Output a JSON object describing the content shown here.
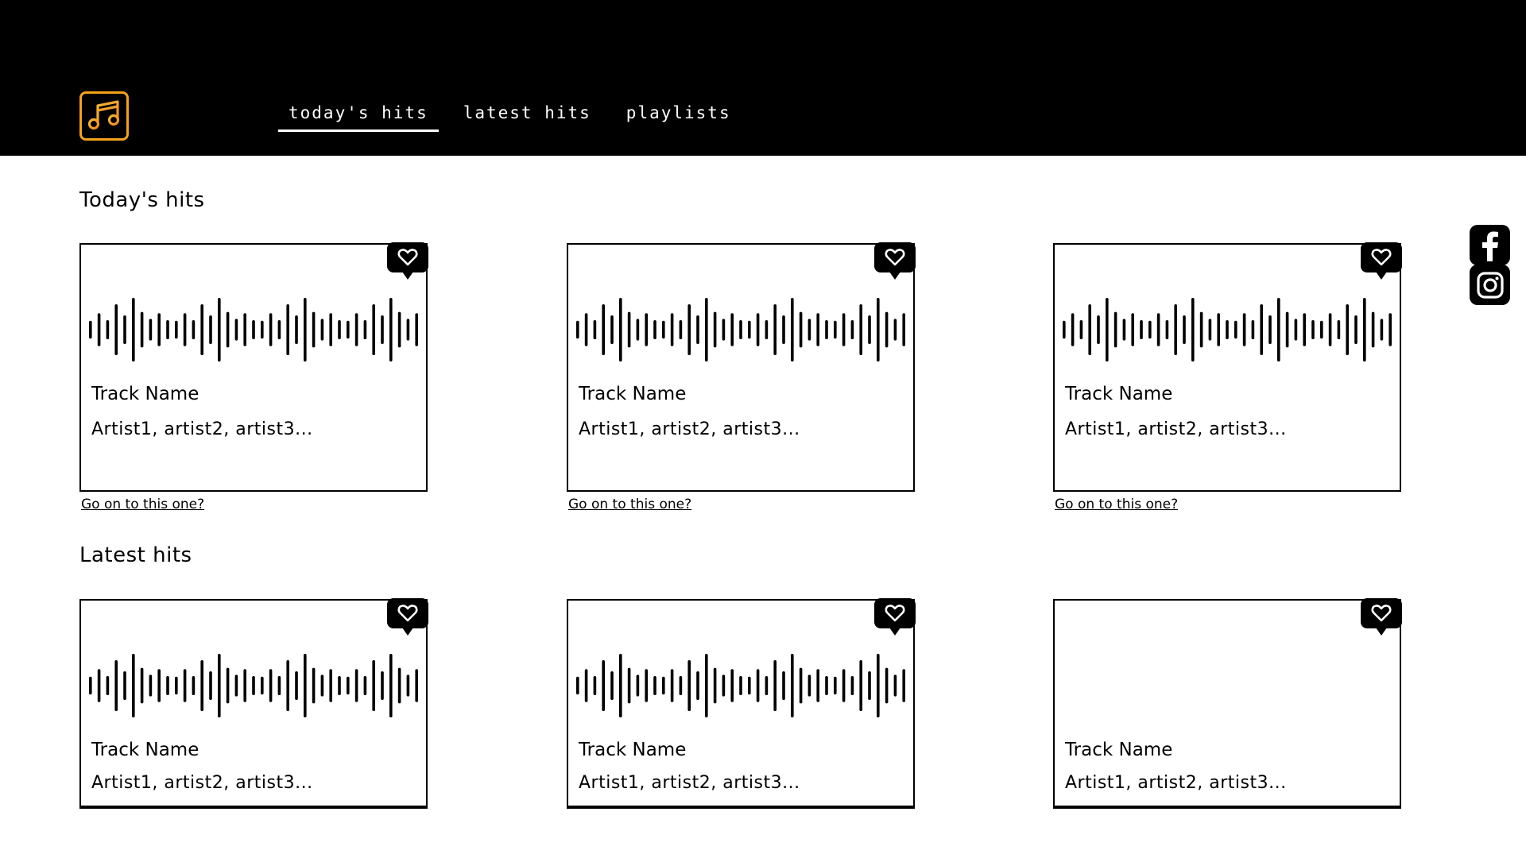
{
  "nav": {
    "items": [
      {
        "label": "today's hits",
        "active": true
      },
      {
        "label": "latest hits",
        "active": false
      },
      {
        "label": "playlists",
        "active": false
      }
    ]
  },
  "sections": [
    {
      "title": "Today's hits",
      "cards": [
        {
          "track": "Track Name",
          "artists": "Artist1, artist2, artist3...",
          "link": "Go on to this one?"
        },
        {
          "track": "Track Name",
          "artists": "Artist1, artist2, artist3...",
          "link": "Go on to this one?"
        },
        {
          "track": "Track Name",
          "artists": "Artist1, artist2, artist3...",
          "link": "Go on to this one?"
        }
      ]
    },
    {
      "title": "Latest hits",
      "cards": [
        {
          "track": "Track Name",
          "artists": "Artist1, artist2, artist3..."
        },
        {
          "track": "Track Name",
          "artists": "Artist1, artist2, artist3..."
        },
        {
          "track": "Track Name",
          "artists": "Artist1, artist2, artist3..."
        }
      ]
    }
  ],
  "icons": {
    "logo": "music-note-icon",
    "favorite": "heart-icon",
    "facebook": "facebook-icon",
    "instagram": "instagram-icon"
  },
  "colors": {
    "header": "#000000",
    "logo_accent": "#f5a11a",
    "background": "#ffffff"
  }
}
